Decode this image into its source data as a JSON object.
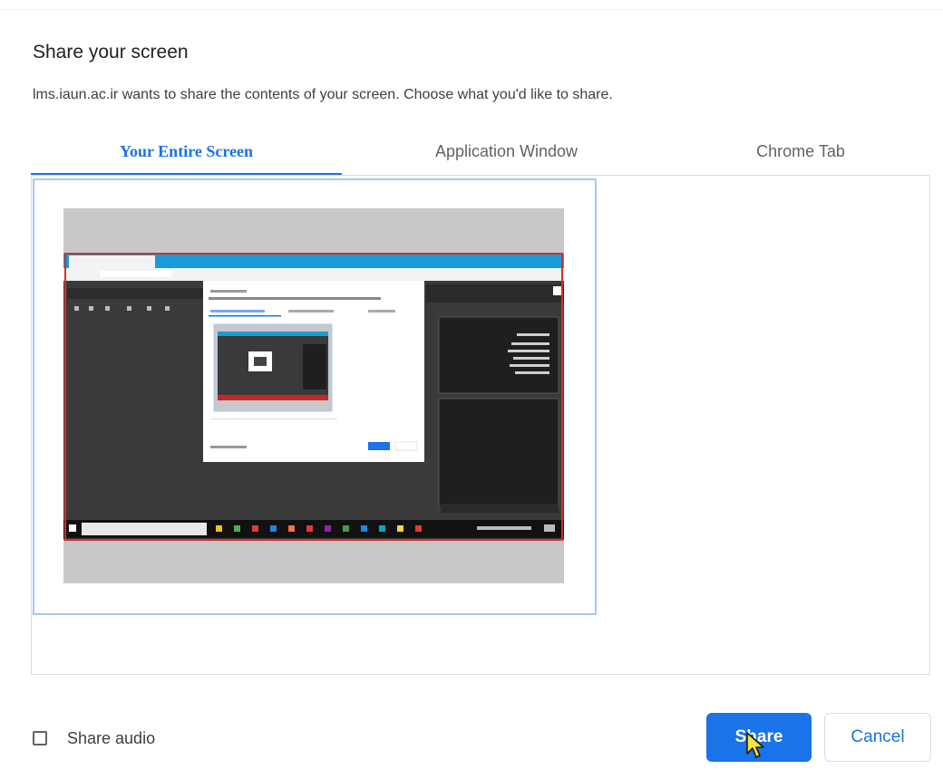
{
  "dialog": {
    "title": "Share your screen",
    "description": "lms.iaun.ac.ir wants to share the contents of your screen. Choose what you'd like to share."
  },
  "tabs": [
    {
      "label": "Your Entire Screen",
      "active": true
    },
    {
      "label": "Application Window",
      "active": false
    },
    {
      "label": "Chrome Tab",
      "active": false
    }
  ],
  "audio": {
    "label": "Share audio",
    "checked": false
  },
  "buttons": {
    "share": "Share",
    "cancel": "Cancel"
  },
  "colors": {
    "accent": "#1a73e8",
    "selection_border": "#a8c7fa",
    "thumbnail_frame": "#c8c8c8"
  },
  "icons": {
    "cursor": "mouse-pointer-icon",
    "checkbox": "checkbox-icon"
  }
}
